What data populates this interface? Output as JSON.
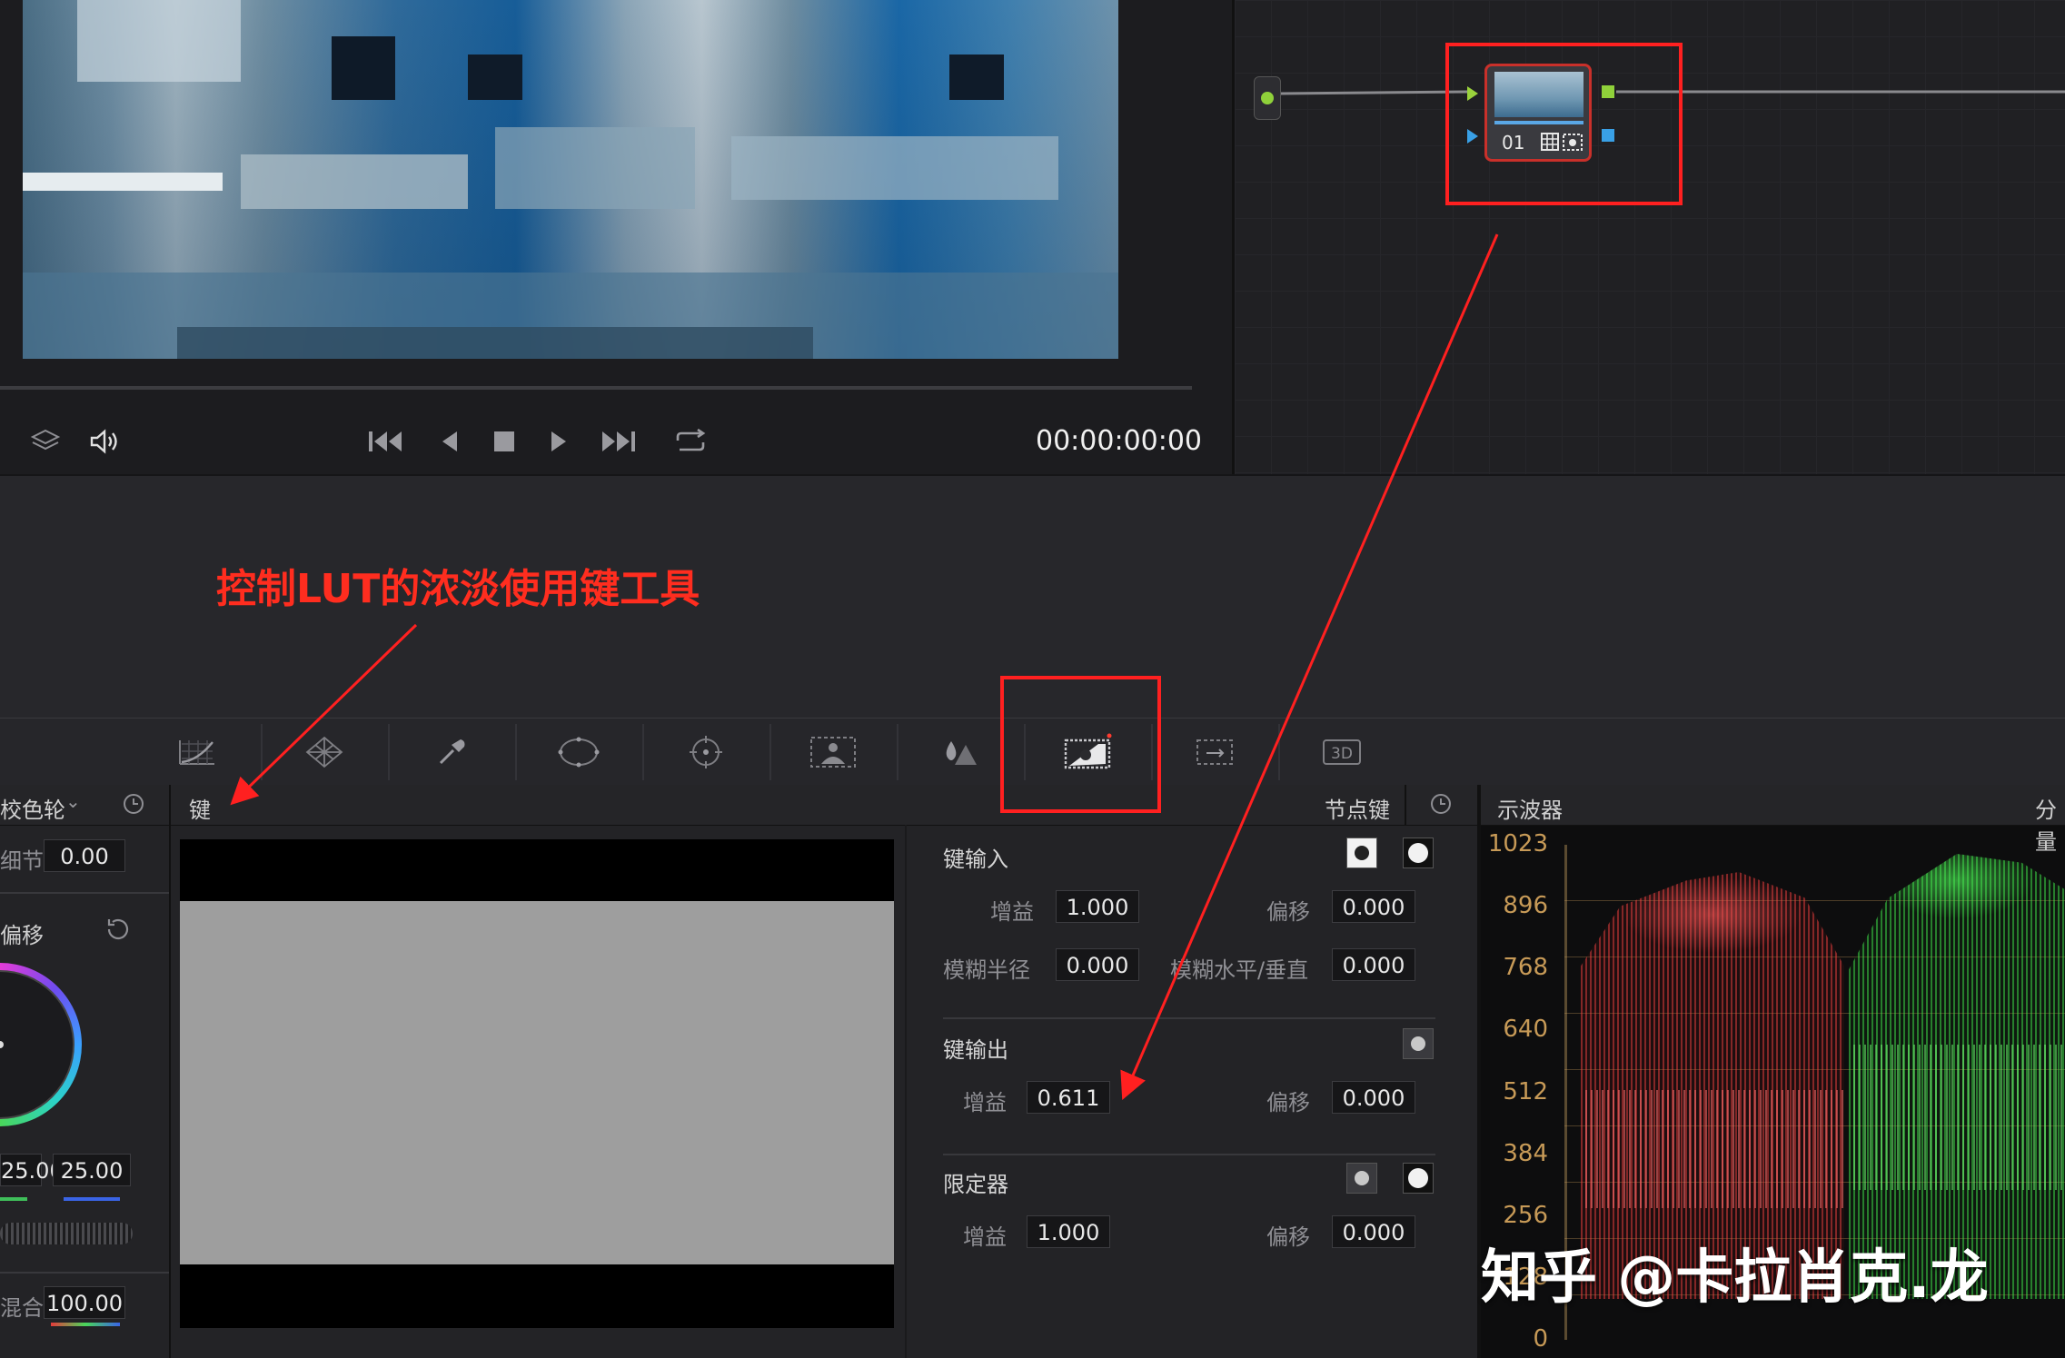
{
  "viewer": {
    "timecode": "00:00:00:00"
  },
  "transport": {
    "icons": [
      "layers-icon",
      "speaker-icon",
      "skip-start-icon",
      "play-reverse-icon",
      "stop-icon",
      "play-icon",
      "skip-end-icon",
      "loop-icon"
    ]
  },
  "node": {
    "label": "01"
  },
  "annotation": {
    "text": "控制LUT的浓淡使用键工具"
  },
  "color_panel": {
    "mode_label": "校色轮",
    "detail_label": "细节",
    "detail_value": "0.00",
    "offset_label": "偏移",
    "val_a": "25.00",
    "val_b": "25.00",
    "mix_label": "混合",
    "mix_value": "100.00"
  },
  "key_panel": {
    "title": "键",
    "node_key_label": "节点键",
    "key_input": {
      "title": "键输入",
      "gain_label": "增益",
      "gain_value": "1.000",
      "offset_label": "偏移",
      "offset_value": "0.000",
      "blur_radius_label": "模糊半径",
      "blur_radius_value": "0.000",
      "blur_hv_label": "模糊水平/垂直",
      "blur_hv_value": "0.000"
    },
    "key_output": {
      "title": "键输出",
      "gain_label": "增益",
      "gain_value": "0.611",
      "offset_label": "偏移",
      "offset_value": "0.000"
    },
    "qualifier": {
      "title": "限定器",
      "gain_label": "增益",
      "gain_value": "1.000",
      "offset_label": "偏移",
      "offset_value": "0.000"
    }
  },
  "scope": {
    "title": "示波器",
    "right_label": "分量",
    "y_ticks": [
      "1023",
      "896",
      "768",
      "640",
      "512",
      "384",
      "256",
      "128",
      "0"
    ]
  },
  "watermark": "知乎 @卡拉肖克.龙",
  "colors": {
    "annotation_red": "#ff2d1f",
    "scope_label": "#c79a57"
  }
}
